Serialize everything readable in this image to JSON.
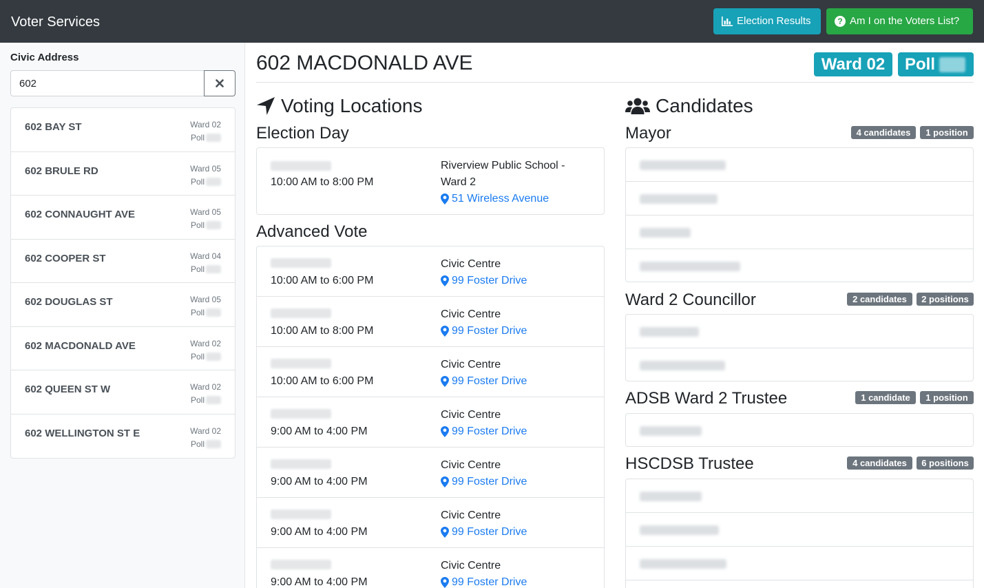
{
  "app": {
    "title": "Voter Services",
    "results_label": "Election Results",
    "voters_label": "Am I on the Voters List?"
  },
  "sidebar": {
    "label": "Civic Address",
    "search_value": "602",
    "addresses": [
      {
        "name": "602 BAY ST",
        "ward": "Ward 02",
        "poll_label": "Poll"
      },
      {
        "name": "602 BRULE RD",
        "ward": "Ward 05",
        "poll_label": "Poll"
      },
      {
        "name": "602 CONNAUGHT AVE",
        "ward": "Ward 05",
        "poll_label": "Poll"
      },
      {
        "name": "602 COOPER ST",
        "ward": "Ward 04",
        "poll_label": "Poll"
      },
      {
        "name": "602 DOUGLAS ST",
        "ward": "Ward 05",
        "poll_label": "Poll"
      },
      {
        "name": "602 MACDONALD AVE",
        "ward": "Ward 02",
        "poll_label": "Poll"
      },
      {
        "name": "602 QUEEN ST W",
        "ward": "Ward 02",
        "poll_label": "Poll"
      },
      {
        "name": "602 WELLINGTON ST E",
        "ward": "Ward 02",
        "poll_label": "Poll"
      }
    ]
  },
  "main": {
    "title": "602 MACDONALD AVE",
    "ward_badge": "Ward 02",
    "poll_badge": "Poll"
  },
  "voting": {
    "heading": "Voting Locations",
    "election_day_heading": "Election Day",
    "election_day": {
      "time": "10:00 AM to 8:00 PM",
      "place": "Riverview Public School - Ward 2",
      "address": "51 Wireless Avenue"
    },
    "advanced_heading": "Advanced Vote",
    "advanced": [
      {
        "time": "10:00 AM to 6:00 PM",
        "place": "Civic Centre",
        "address": "99 Foster Drive"
      },
      {
        "time": "10:00 AM to 8:00 PM",
        "place": "Civic Centre",
        "address": "99 Foster Drive"
      },
      {
        "time": "10:00 AM to 6:00 PM",
        "place": "Civic Centre",
        "address": "99 Foster Drive"
      },
      {
        "time": "9:00 AM to 4:00 PM",
        "place": "Civic Centre",
        "address": "99 Foster Drive"
      },
      {
        "time": "9:00 AM to 4:00 PM",
        "place": "Civic Centre",
        "address": "99 Foster Drive"
      },
      {
        "time": "9:00 AM to 4:00 PM",
        "place": "Civic Centre",
        "address": "99 Foster Drive"
      },
      {
        "time": "9:00 AM to 4:00 PM",
        "place": "Civic Centre",
        "address": "99 Foster Drive"
      }
    ]
  },
  "candidates": {
    "heading": "Candidates",
    "races": [
      {
        "title": "Mayor",
        "count": "4 candidates",
        "positions": "1 position"
      },
      {
        "title": "Ward 2 Councillor",
        "count": "2 candidates",
        "positions": "2 positions"
      },
      {
        "title": "ADSB Ward 2 Trustee",
        "count": "1 candidate",
        "positions": "1 position"
      },
      {
        "title": "HSCDSB Trustee",
        "count": "4 candidates",
        "positions": "6 positions"
      }
    ]
  },
  "colors": {
    "navbar": "#343a40",
    "info": "#17a2b8",
    "success": "#28a745",
    "secondary": "#6c757d",
    "link": "#1a7bf0"
  }
}
